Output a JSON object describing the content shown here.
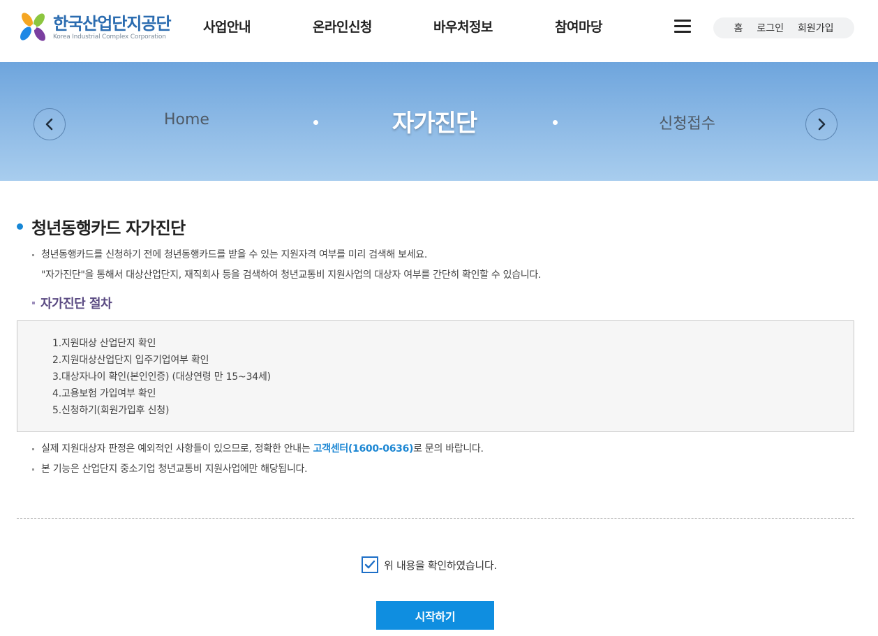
{
  "header": {
    "logo_title": "한국산업단지공단",
    "logo_subtitle": "Korea Industrial Complex Corporation",
    "gnb": [
      "사업안내",
      "온라인신청",
      "바우처정보",
      "참여마당"
    ],
    "util": {
      "home": "홈",
      "login": "로그인",
      "signup": "회원가입"
    }
  },
  "banner": {
    "prev": "Home",
    "current": "자가진단",
    "next": "신청접수"
  },
  "content": {
    "title": "청년동행카드 자가진단",
    "desc_line1": "청년동행카드를 신청하기 전에 청년동행카드를 받을 수 있는 지원자격 여부를 미리 검색해 보세요.",
    "desc_line2": "\"자가진단\"을 통해서 대상산업단지, 재직회사 등을 검색하여 청년교통비 지원사업의 대상자 여부를 간단히 확인할 수 있습니다.",
    "procedure_title": "자가진단 절차",
    "steps": [
      "1.지원대상 산업단지 확인",
      "2.지원대상산업단지 입주기업여부 확인",
      "3.대상자나이 확인(본인인증) (대상연령 만 15~34세)",
      "4.고용보험 가입여부 확인",
      "5.신청하기(회원가입후 신청)"
    ],
    "note1_pre": "실제 지원대상자 판정은 예외적인 사항들이 있으므로, 정확한 안내는 ",
    "note1_highlight": "고객센터(1600-0636)",
    "note1_post": "로 문의 바랍니다.",
    "note2": "본 기능은 산업단지 중소기업 청년교통비 지원사업에만 해당됩니다.",
    "agree_label": "위 내용을 확인하였습니다.",
    "agree_checked": true,
    "start_button": "시작하기"
  },
  "colors": {
    "brand_blue": "#2b6cb0",
    "accent": "#0f8ee0",
    "highlight": "#1d87d3",
    "subheading": "#5a4a82"
  }
}
